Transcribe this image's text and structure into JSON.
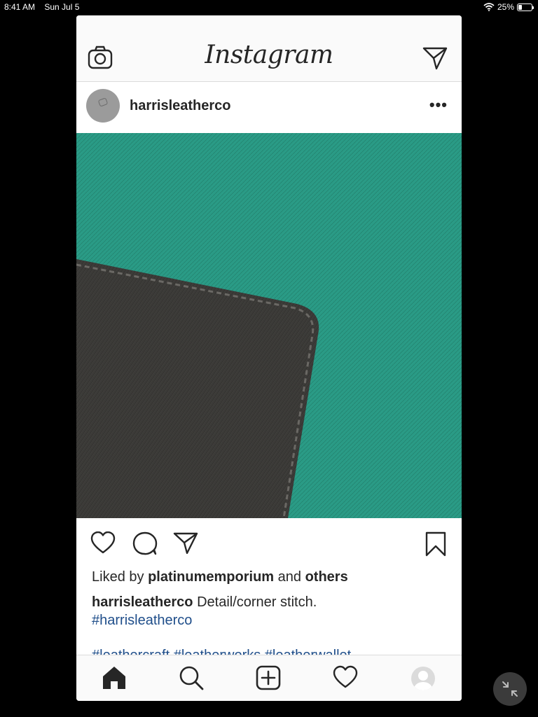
{
  "status": {
    "time": "8:41 AM",
    "date": "Sun Jul 5",
    "battery": "25%",
    "battery_level": 0.25,
    "wifi_icon": "wifi-icon"
  },
  "header": {
    "logo": "Instagram",
    "left_icon": "camera-icon",
    "right_icon": "direct-message-icon"
  },
  "post": {
    "username": "harrisleatherco",
    "more_icon": "more-options-icon",
    "likes_prefix": "Liked by",
    "liked_by_user": "platinumemporium",
    "likes_and": "and",
    "likes_others": "others",
    "caption_user": "harrisleatherco",
    "caption_text": "Detail/corner stitch.",
    "caption_tag": "#harrisleatherco",
    "tags_line": "#leathercraft #leatherworks #leatherwallet",
    "colors": {
      "background_leather": "#2a9b86",
      "wallet_leather": "#3e3d3b",
      "link": "#1f4e8a"
    }
  },
  "actions": [
    "heart-icon",
    "comment-icon",
    "share-icon",
    "bookmark-icon"
  ],
  "tabbar": [
    "home-icon",
    "search-icon",
    "add-post-icon",
    "activity-heart-icon",
    "profile-avatar"
  ]
}
